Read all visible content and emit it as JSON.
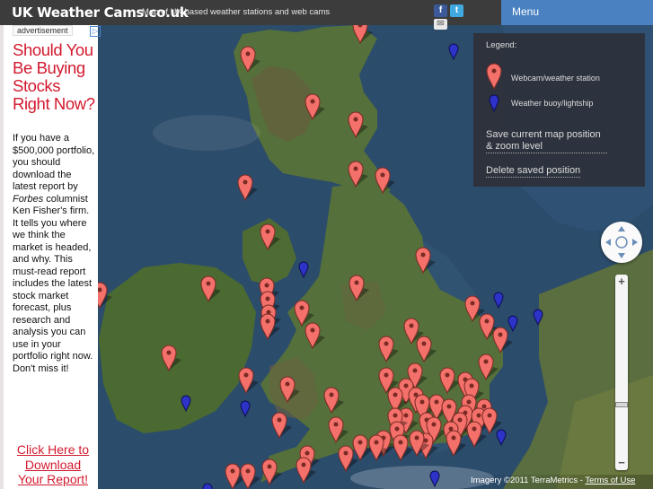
{
  "header": {
    "site_title": "UK Weather Cams.co.uk",
    "tagline": "Map of UK based weather stations and web cams",
    "menu_label": "Menu",
    "facebook_icon": "facebook-icon",
    "twitter_icon": "twitter-icon",
    "email_icon": "email-icon"
  },
  "advertisement": {
    "label": "advertisement",
    "headline": "Should You Be Buying Stocks Right Now?",
    "body_parts": [
      "If you have a $500,000 portfolio, you should download the latest report by ",
      "Forbes",
      " columnist Ken Fisher's firm. It tells you where we think the market is headed, and why. This must-read report includes the latest stock market forecast, plus research and analysis you can use in your portfolio right now. Don't miss it!"
    ],
    "cta": "Click Here to Download Your Report!"
  },
  "legend": {
    "title": "Legend:",
    "webcam_label": "Webcam/weather station",
    "buoy_label": "Weather buoy/lightship",
    "save_link": "Save current map position & zoom level",
    "delete_link": "Delete saved position"
  },
  "map": {
    "attribution_text": "Imagery ©2011 TerraMetrics - ",
    "terms_link": "Terms of Use",
    "colors": {
      "sea": "#2c4c6b",
      "land": "#4d6a34",
      "webcam_marker": "#f4706a",
      "buoy_marker": "#2d32c8"
    }
  }
}
